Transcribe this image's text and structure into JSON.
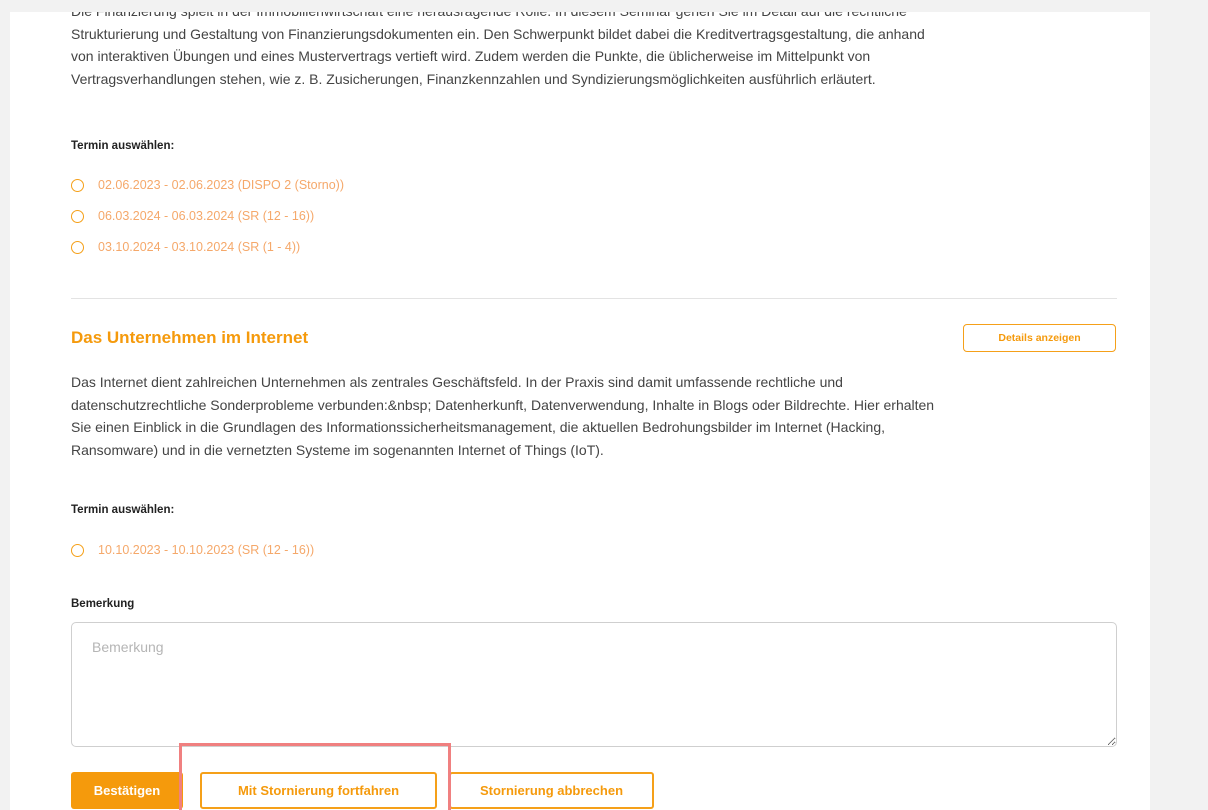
{
  "seminar1": {
    "description": "Die Finanzierung spielt in der Immobilienwirtschaft eine herausragende Rolle. In diesem Seminar gehen Sie im Detail auf die rechtliche Strukturierung und Gestaltung von Finanzierungsdokumenten ein. Den Schwerpunkt bildet dabei die Kreditvertragsgestaltung, die anhand von interaktiven Übungen und eines Mustervertrags vertieft wird. Zudem werden die Punkte, die üblicherweise im Mittelpunkt von Vertragsverhandlungen stehen, wie z. B. Zusicherungen, Finanzkennzahlen und Syndizierungsmöglichkeiten ausführlich erläutert.",
    "termin_label": "Termin auswählen:",
    "options": [
      "02.06.2023 - 02.06.2023 (DISPO 2 (Storno))",
      "06.03.2024 - 06.03.2024 (SR (12 - 16))",
      "03.10.2024 - 03.10.2024 (SR (1 - 4))"
    ]
  },
  "seminar2": {
    "title": "Das Unternehmen im Internet",
    "details_button": "Details anzeigen",
    "description": "Das Internet dient zahlreichen Unternehmen als zentrales Geschäftsfeld. In der Praxis sind damit umfassende rechtliche und datenschutzrechtliche Sonderprobleme verbunden:&nbsp; Datenherkunft, Datenverwendung, Inhalte in Blogs oder Bildrechte. Hier erhalten Sie einen Einblick in die Grundlagen des Informationssicherheitsmanagement, die aktuellen Bedrohungsbilder im Internet (Hacking, Ransomware) und in die vernetzten Systeme im sogenannten Internet of Things (IoT).",
    "termin_label": "Termin auswählen:",
    "options": [
      "10.10.2023 - 10.10.2023 (SR (12 - 16))"
    ]
  },
  "remark": {
    "label": "Bemerkung",
    "placeholder": "Bemerkung",
    "value": ""
  },
  "actions": {
    "confirm": "Bestätigen",
    "continue_cancellation": "Mit Stornierung fortfahren",
    "abort_cancellation": "Stornierung abbrechen"
  },
  "colors": {
    "accent": "#f59a0c",
    "highlight": "#f08080"
  }
}
